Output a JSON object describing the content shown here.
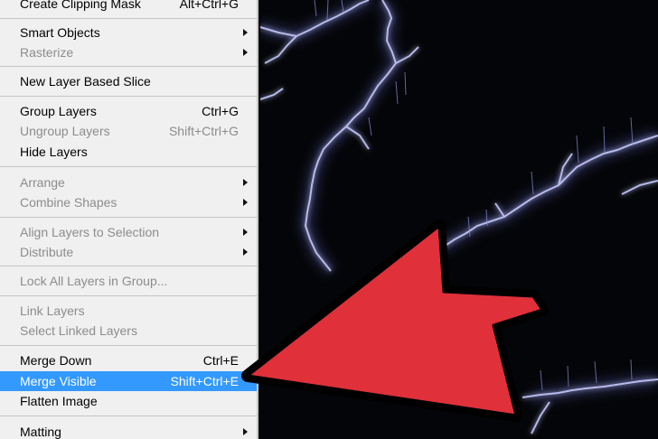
{
  "menu": {
    "items": [
      {
        "label": "Create Clipping Mask",
        "shortcut": "Alt+Ctrl+G"
      },
      {
        "label": "Smart Objects",
        "shortcut": ""
      },
      {
        "label": "Rasterize",
        "shortcut": ""
      },
      {
        "label": "New Layer Based Slice",
        "shortcut": ""
      },
      {
        "label": "Group Layers",
        "shortcut": "Ctrl+G"
      },
      {
        "label": "Ungroup Layers",
        "shortcut": "Shift+Ctrl+G"
      },
      {
        "label": "Hide Layers",
        "shortcut": ""
      },
      {
        "label": "Arrange",
        "shortcut": ""
      },
      {
        "label": "Combine Shapes",
        "shortcut": ""
      },
      {
        "label": "Align Layers to Selection",
        "shortcut": ""
      },
      {
        "label": "Distribute",
        "shortcut": ""
      },
      {
        "label": "Lock All Layers in Group...",
        "shortcut": ""
      },
      {
        "label": "Link Layers",
        "shortcut": ""
      },
      {
        "label": "Select Linked Layers",
        "shortcut": ""
      },
      {
        "label": "Merge Down",
        "shortcut": "Ctrl+E"
      },
      {
        "label": "Merge Visible",
        "shortcut": "Shift+Ctrl+E"
      },
      {
        "label": "Flatten Image",
        "shortcut": ""
      },
      {
        "label": "Matting",
        "shortcut": ""
      }
    ]
  },
  "colors": {
    "menu_background": "#f0f0f0",
    "highlight": "#3399ff",
    "disabled_text": "#8c8c8c",
    "pointer_arrow": "#e0303a",
    "lightning": "#b8bcff"
  },
  "icons": {
    "submenu": "chevron-right-icon",
    "pointer": "pointer-arrow-icon"
  }
}
